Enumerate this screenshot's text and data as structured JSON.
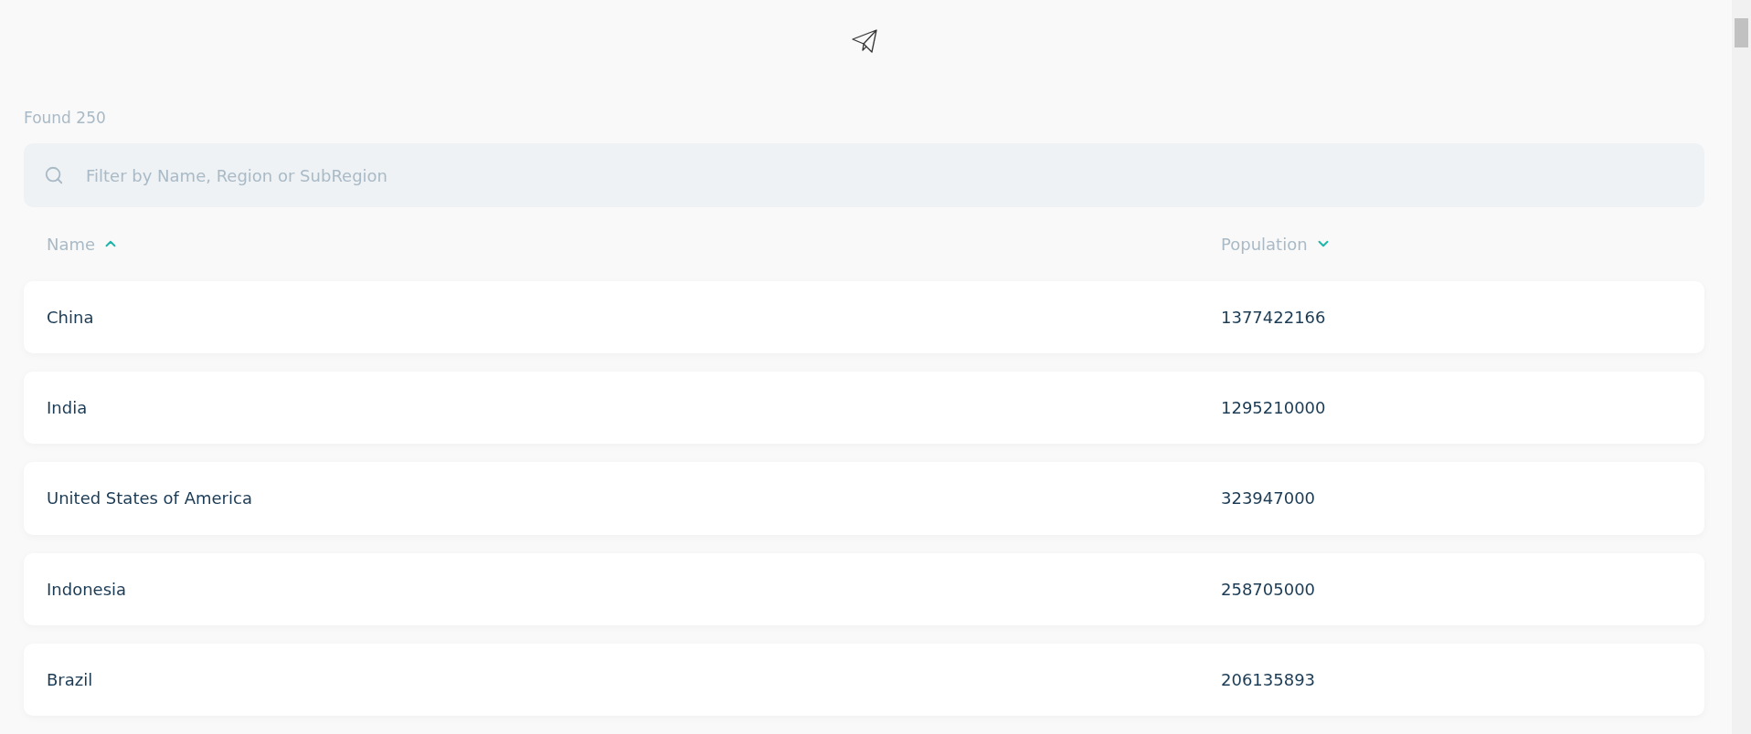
{
  "found": "Found 250",
  "search": {
    "placeholder": "Filter by Name, Region or SubRegion"
  },
  "columns": [
    {
      "label": "Name",
      "ascending": true
    },
    {
      "label": "Population",
      "ascending": false
    }
  ],
  "rows": [
    {
      "name": "China",
      "population": "1377422166"
    },
    {
      "name": "India",
      "population": "1295210000"
    },
    {
      "name": "United States of America",
      "population": "323947000"
    },
    {
      "name": "Indonesia",
      "population": "258705000"
    },
    {
      "name": "Brazil",
      "population": "206135893"
    }
  ]
}
